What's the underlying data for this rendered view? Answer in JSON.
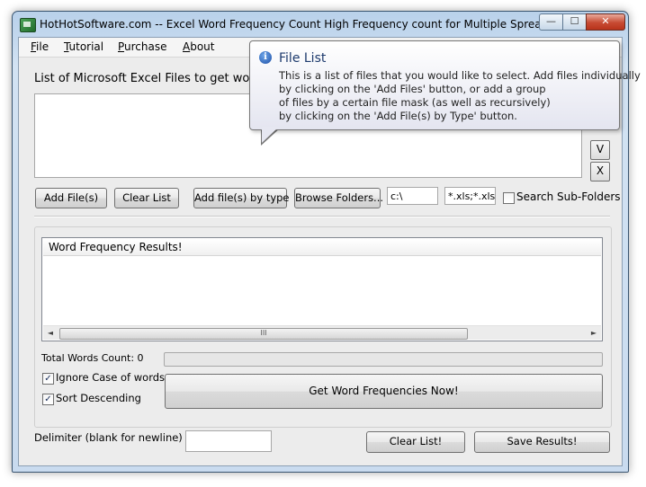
{
  "window": {
    "title": "HotHotSoftware.com -- Excel Word Frequency Count High Frequency count for Multiple Spreadsheets...",
    "min_glyph": "—",
    "max_glyph": "☐",
    "close_glyph": "✕"
  },
  "menu": [
    {
      "label": "File"
    },
    {
      "label": "Tutorial"
    },
    {
      "label": "Purchase"
    },
    {
      "label": "About"
    }
  ],
  "files": {
    "label": "List of Microsoft Excel Files to get word fre",
    "down_glyph": "V",
    "remove_glyph": "X"
  },
  "toolbar": {
    "add_files": "Add File(s)",
    "clear_list": "Clear List",
    "add_by_type": "Add file(s) by type",
    "browse_folders": "Browse Folders...",
    "folder_value": "c:\\",
    "mask_value": "*.xls;*.xlsx",
    "search_subfolders": "Search Sub-Folders",
    "search_subfolders_checked": false
  },
  "results": {
    "header": "Word Frequency Results!",
    "scroll_left": "◄",
    "scroll_right": "►",
    "scroll_grip": "III"
  },
  "stats": {
    "total_words": "Total Words Count: 0",
    "ignore_case": "Ignore Case of words",
    "ignore_case_checked": true,
    "sort_descending": "Sort Descending",
    "sort_descending_checked": true,
    "check_glyph": "✓",
    "get_frequencies": "Get Word Frequencies Now!"
  },
  "footer": {
    "delimiter_label": "Delimiter (blank for newline)",
    "delimiter_value": "",
    "clear_list": "Clear List!",
    "save_results": "Save Results!"
  },
  "tooltip": {
    "icon": "i",
    "title": "File List",
    "lines": [
      "This is a list of files that you would like to select. Add files individually",
      "by clicking on the 'Add Files' button, or add a group",
      "of files by a certain file mask (as well as recursively)",
      "by clicking on the 'Add File(s) by Type' button."
    ]
  }
}
